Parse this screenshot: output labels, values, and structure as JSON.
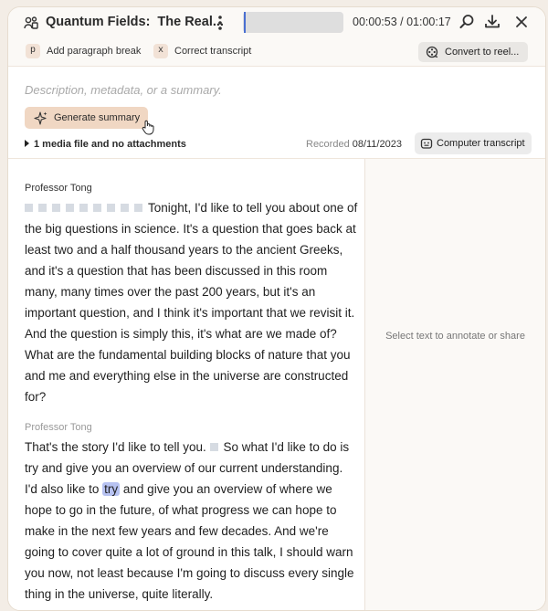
{
  "header": {
    "title_part1": "Quantum Fields:",
    "title_part2": "The Real...",
    "time": "00:00:53 / 01:00:17",
    "icons": [
      "people-icon",
      "more-vertical-icon",
      "search-icon",
      "download-icon",
      "close-icon"
    ]
  },
  "shortcuts": [
    {
      "key": "p",
      "label": "Add paragraph break"
    },
    {
      "key": "x",
      "label": "Correct transcript"
    }
  ],
  "convert_button": "Convert to reel...",
  "description": {
    "placeholder": "Description, metadata, or a summary.",
    "generate_button": "Generate summary",
    "media_summary": "1 media file and no attachments",
    "recorded_label": "Recorded",
    "recorded_date": "08/11/2023",
    "transcript_button": "Computer transcript"
  },
  "transcript": [
    {
      "speaker": "Professor Tong",
      "parts": {
        "a": "Tonight, I'd like to tell you about one of the big questions in science. It's a question that goes back at least two and a half thousand years to the ancient Greeks, and it's a question that has been discussed in this room many, many times over the past 200 years, but it's an important question, and I think it's important that we revisit it. And the question is simply this, it's what are we made of? What are the fundamental building blocks of nature that you and me and everything else in the universe are constructed for?"
      }
    },
    {
      "speaker": "Professor Tong",
      "parts": {
        "a": "That's the story I'd like to tell you.",
        "b": "So what I'd like to do is try and give you an overview of our current understanding. I'd also like to",
        "highlight": "try",
        "c": "and give you an overview of where we hope to go in the future, of what progress we can hope to make in the next few years and few decades. And we're going to cover quite a lot of ground in this talk, I should warn you now, not least because I'm going to discuss every single thing in the universe, quite literally."
      }
    }
  ],
  "side_hint": "Select text to annotate or share",
  "colors": {
    "accent_button": "#f0d7c3",
    "highlight": "#b7c2f1",
    "playhead": "#4a6fd1"
  }
}
